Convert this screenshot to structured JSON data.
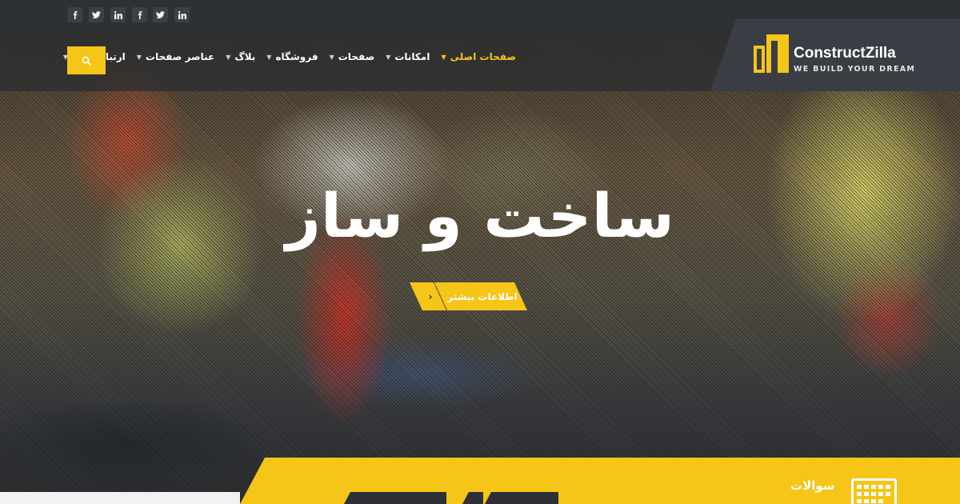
{
  "colors": {
    "accent": "#f5c518",
    "topbar": "#2d3035",
    "logo_panel": "#3a3d43"
  },
  "social": [
    {
      "icon": "facebook-icon"
    },
    {
      "icon": "twitter-icon"
    },
    {
      "icon": "linkedin-icon"
    },
    {
      "icon": "facebook-icon"
    },
    {
      "icon": "twitter-icon"
    },
    {
      "icon": "linkedin-icon"
    }
  ],
  "logo": {
    "title": "ConstructZilla",
    "tagline": "WE BUILD YOUR DREAM"
  },
  "menu": [
    {
      "label": "صفحات اصلی",
      "active": true
    },
    {
      "label": "امکانات"
    },
    {
      "label": "صفحات"
    },
    {
      "label": "فروشگاه"
    },
    {
      "label": "بلاگ"
    },
    {
      "label": "عناصر صفحات"
    },
    {
      "label": "ارتباط با ما"
    }
  ],
  "search": {
    "icon": "search-icon"
  },
  "hero": {
    "title": "ساخت و ساز",
    "cta_label": "اطلاعات بیشتر"
  },
  "features": {
    "title": "سوالات",
    "icon": "calendar-icon"
  }
}
